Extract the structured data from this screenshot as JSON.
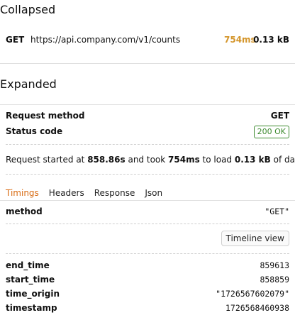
{
  "collapsed": {
    "title": "Collapsed",
    "method": "GET",
    "url": "https://api.company.com/v1/counts",
    "duration": "754ms",
    "size": "0.13 kB"
  },
  "expanded": {
    "title": "Expanded",
    "request_method_label": "Request method",
    "request_method_value": "GET",
    "status_code_label": "Status code",
    "status_code_value": "200 OK",
    "summary": {
      "prefix": "Request started at ",
      "start": "858.86s",
      "mid": " and took ",
      "took": "754ms",
      "mid2": " to load ",
      "size": "0.13 kB",
      "suffix": " of data."
    },
    "tabs": [
      "Timings",
      "Headers",
      "Response",
      "Json"
    ],
    "method_row": {
      "key": "method",
      "value": "\"GET\""
    },
    "timeline_button": "Timeline view",
    "timings": [
      {
        "key": "end_time",
        "value": "859613"
      },
      {
        "key": "start_time",
        "value": "858859"
      },
      {
        "key": "time_origin",
        "value": "\"1726567602079\""
      },
      {
        "key": "timestamp",
        "value": "1726568460938"
      }
    ]
  },
  "colors": {
    "accent": "#d86a11",
    "duration": "#d4952a",
    "status_ok": "#3c8a2e"
  }
}
